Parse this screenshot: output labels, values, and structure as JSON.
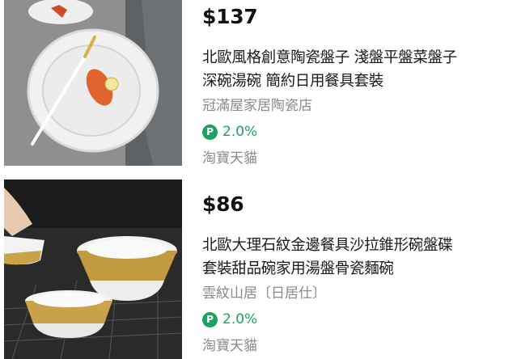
{
  "products": [
    {
      "price": "$137",
      "title": "北歐風格創意陶瓷盤子 淺盤平盤菜盤子\n深碗湯碗 簡約日用餐具套裝",
      "shop": "冠滿屋家居陶瓷店",
      "cashback_icon": "P",
      "cashback_rate": "2.0%",
      "platform": "淘寶天貓"
    },
    {
      "price": "$86",
      "title": "北歐大理石紋金邊餐具沙拉錐形碗盤碟\n套裝甜品碗家用湯盤骨瓷麵碗",
      "shop": "雲紋山居〔日居仕〕",
      "cashback_icon": "P",
      "cashback_rate": "2.0%",
      "platform": "淘寶天貓"
    }
  ]
}
